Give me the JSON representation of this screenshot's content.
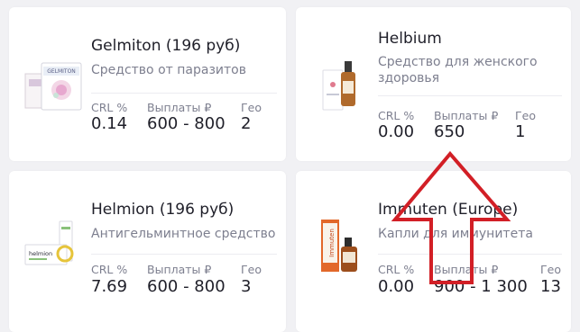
{
  "stat_labels": {
    "crl": "CRL %",
    "payouts": "Выплаты ₽",
    "geo": "Гео"
  },
  "offers": [
    {
      "title": "Gelmiton (196 руб)",
      "subtitle": "Средство от паразитов",
      "crl": "0.14",
      "payouts": "600 - 800",
      "geo": "2",
      "brand_text": "GELMITON"
    },
    {
      "title": "Helbium",
      "subtitle_line1": "Средство для женского",
      "subtitle_line2": "здоровья",
      "crl": "0.00",
      "payouts": "650",
      "geo": "1"
    },
    {
      "title": "Helmion (196 руб)",
      "subtitle": "Антигельминтное средство",
      "crl": "7.69",
      "payouts": "600 - 800",
      "geo": "3",
      "brand_text": "helmion"
    },
    {
      "title": "Immuten (Europe)",
      "subtitle": "Капли для иммунитета",
      "crl": "0.00",
      "payouts": "900 - 1 300",
      "geo": "13",
      "brand_text": "Immuten"
    }
  ],
  "colors": {
    "arrow": "#d21f26",
    "background": "#f1f1f4",
    "card": "#ffffff"
  }
}
